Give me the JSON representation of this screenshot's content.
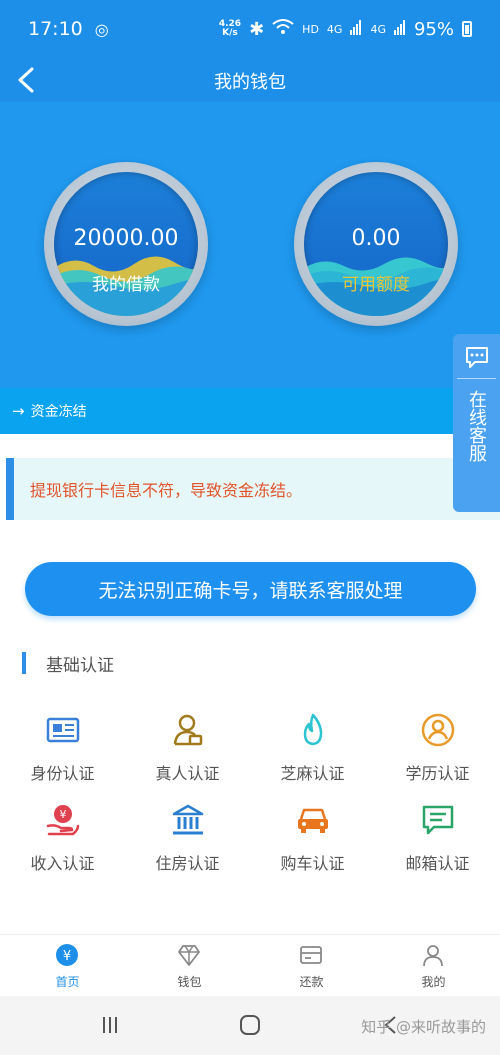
{
  "status_bar": {
    "time": "17:10",
    "speed_value": "4.26",
    "speed_unit": "K/s",
    "hd": "HD",
    "net1": "4G",
    "net2": "4G",
    "battery": "95%"
  },
  "header": {
    "title": "我的钱包"
  },
  "gauges": {
    "loan": {
      "value": "20000.00",
      "label": "我的借款",
      "label_color": "#ffffff"
    },
    "credit": {
      "value": "0.00",
      "label": "可用额度",
      "label_color": "#e8c63a"
    }
  },
  "frozen": {
    "text": "资金冻结"
  },
  "notice": {
    "text": "提现银行卡信息不符，导致资金冻结。"
  },
  "action_button": {
    "label": "无法识别正确卡号，请联系客服处理"
  },
  "section": {
    "title": "基础认证"
  },
  "certifications": [
    {
      "label": "身份认证",
      "icon": "id-card-icon"
    },
    {
      "label": "真人认证",
      "icon": "person-icon"
    },
    {
      "label": "芝麻认证",
      "icon": "flame-icon"
    },
    {
      "label": "学历认证",
      "icon": "graduate-icon"
    },
    {
      "label": "收入认证",
      "icon": "income-icon"
    },
    {
      "label": "住房认证",
      "icon": "bank-building-icon"
    },
    {
      "label": "购车认证",
      "icon": "car-icon"
    },
    {
      "label": "邮箱认证",
      "icon": "mail-message-icon"
    }
  ],
  "tabs": [
    {
      "label": "首页",
      "active": true
    },
    {
      "label": "钱包",
      "active": false
    },
    {
      "label": "还款",
      "active": false
    },
    {
      "label": "我的",
      "active": false
    }
  ],
  "customer_service": {
    "label": "在线客服"
  },
  "watermark": {
    "text": "知乎 @来听故事的"
  },
  "colors": {
    "primary": "#1e8fe8",
    "notice_text": "#e2542a",
    "credit_label": "#e8c63a"
  }
}
